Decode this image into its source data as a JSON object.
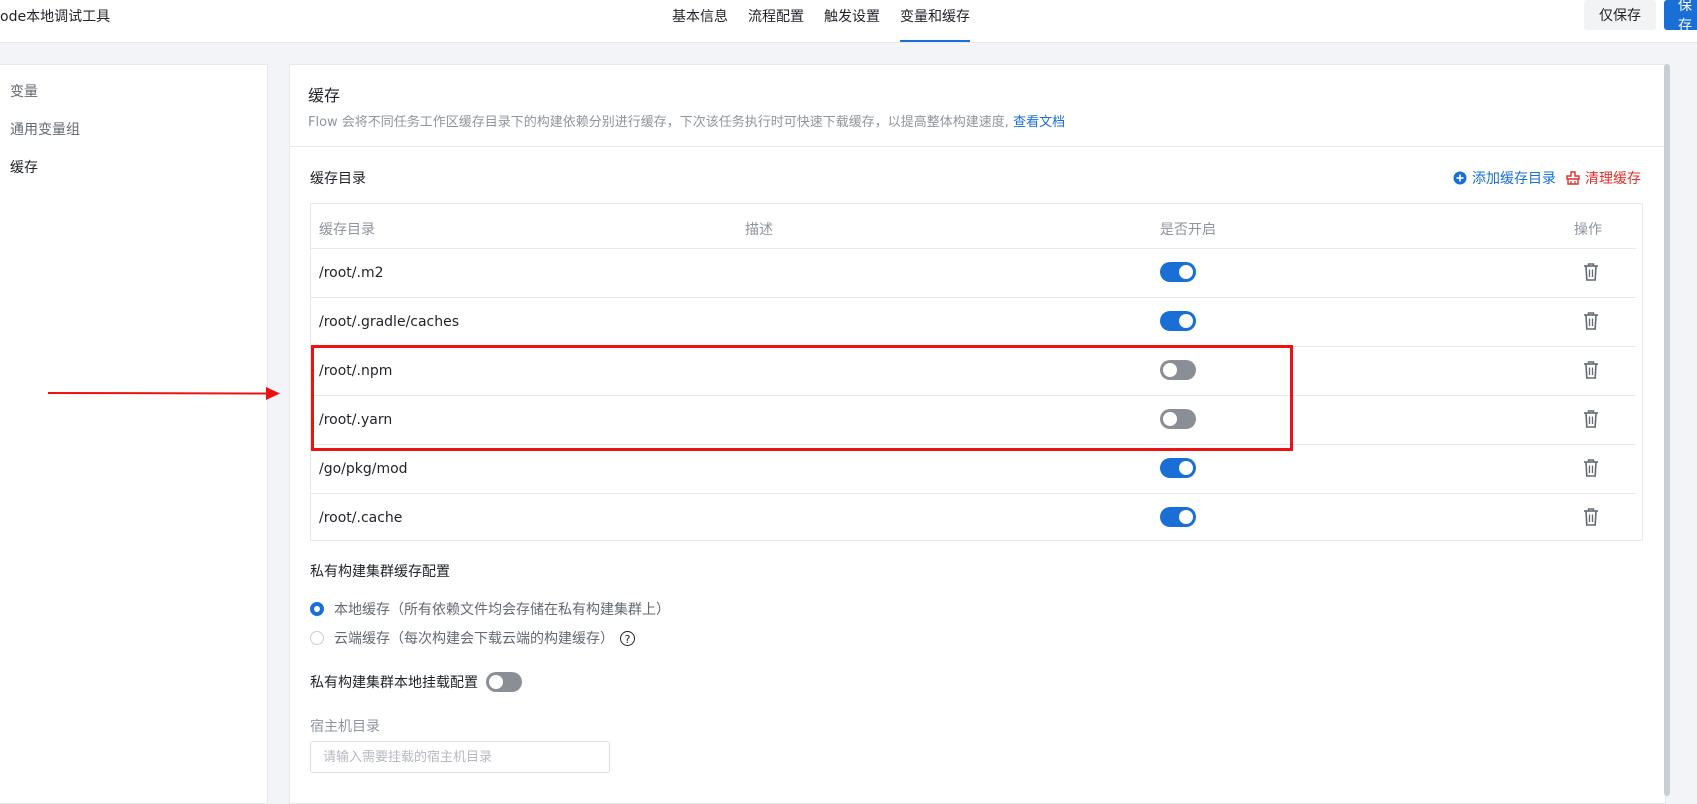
{
  "header": {
    "app_title": "ode本地调试工具",
    "tabs": [
      {
        "label": "基本信息"
      },
      {
        "label": "流程配置"
      },
      {
        "label": "触发设置"
      },
      {
        "label": "变量和缓存",
        "active": true
      }
    ],
    "save_draft_label": "仅保存",
    "save_label": "保存"
  },
  "sidebar": {
    "items": [
      {
        "label": "变量"
      },
      {
        "label": "通用变量组"
      },
      {
        "label": "缓存",
        "active": true
      }
    ]
  },
  "cache": {
    "title": "缓存",
    "description": "Flow 会将不同任务工作区缓存目录下的构建依赖分别进行缓存，下次该任务执行时可快速下载缓存，以提高整体构建速度,",
    "doc_link": "查看文档",
    "dirs_title": "缓存目录",
    "add_dir_label": "添加缓存目录",
    "clear_cache_label": "清理缓存",
    "columns": [
      "缓存目录",
      "描述",
      "是否开启",
      "操作"
    ],
    "rows": [
      {
        "path": "/root/.m2",
        "desc": "",
        "enabled": true
      },
      {
        "path": "/root/.gradle/caches",
        "desc": "",
        "enabled": true
      },
      {
        "path": "/root/.npm",
        "desc": "",
        "enabled": false
      },
      {
        "path": "/root/.yarn",
        "desc": "",
        "enabled": false
      },
      {
        "path": "/go/pkg/mod",
        "desc": "",
        "enabled": true
      },
      {
        "path": "/root/.cache",
        "desc": "",
        "enabled": true
      }
    ]
  },
  "private_cluster": {
    "title": "私有构建集群缓存配置",
    "options": [
      {
        "label": "本地缓存（所有依赖文件均会存储在私有构建集群上）",
        "checked": true
      },
      {
        "label": "云端缓存（每次构建会下载云端的构建缓存）",
        "checked": false
      }
    ],
    "mount_label": "私有构建集群本地挂载配置",
    "mount_enabled": false,
    "host_dir_label": "宿主机目录",
    "host_dir_placeholder": "请输入需要挂载的宿主机目录",
    "host_dir_value": ""
  },
  "colors": {
    "accent": "#1a6fd6",
    "danger": "#e0312c",
    "annotation": "#ee1111",
    "toggle_off": "#8a8f97"
  }
}
